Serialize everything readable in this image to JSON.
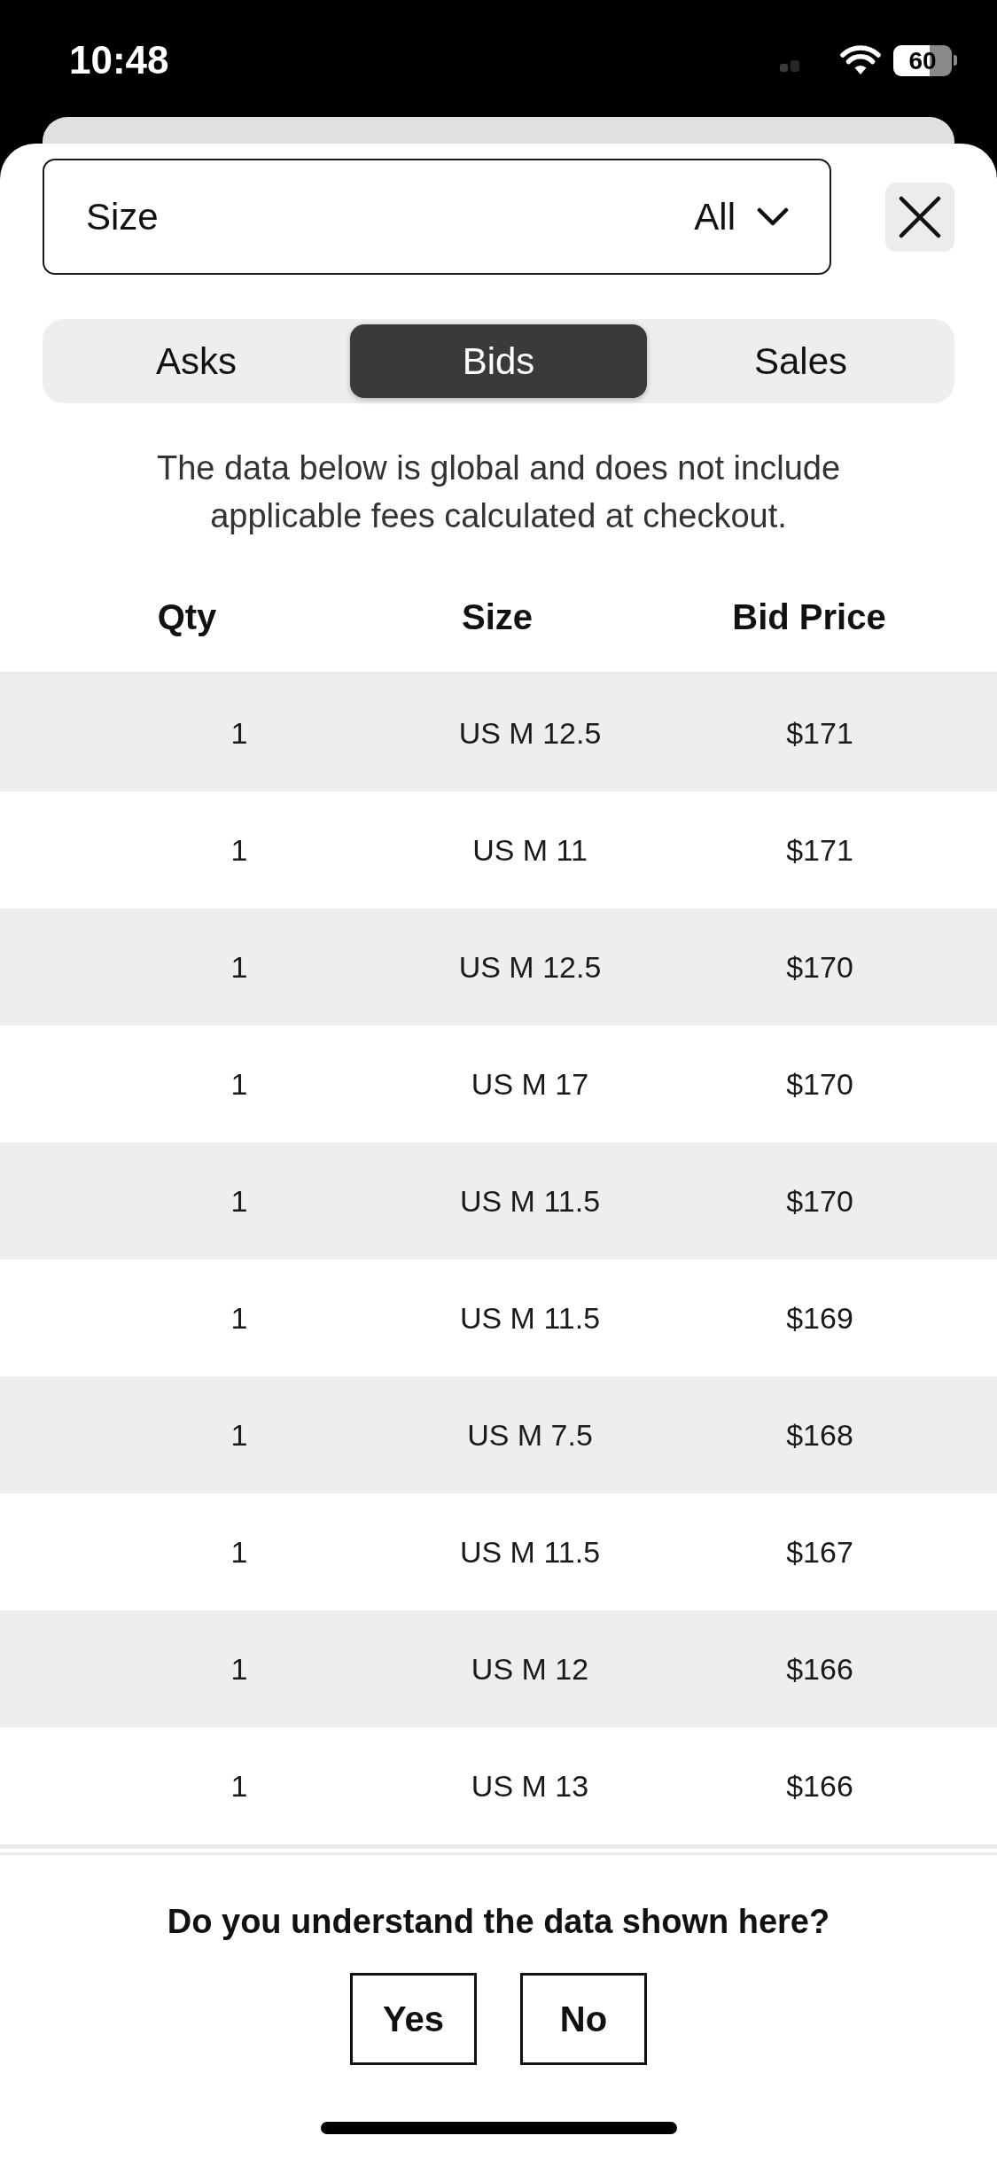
{
  "status_bar": {
    "time": "10:48",
    "battery": "60"
  },
  "filter": {
    "label": "Size",
    "value": "All"
  },
  "tabs": [
    {
      "label": "Asks",
      "selected": false
    },
    {
      "label": "Bids",
      "selected": true
    },
    {
      "label": "Sales",
      "selected": false
    }
  ],
  "notice": "The data below is global and does not include applicable fees calculated at checkout.",
  "table": {
    "columns": [
      "Qty",
      "Size",
      "Bid Price"
    ],
    "rows": [
      [
        "1",
        "US M 12.5",
        "$171"
      ],
      [
        "1",
        "US M 11",
        "$171"
      ],
      [
        "1",
        "US M 12.5",
        "$170"
      ],
      [
        "1",
        "US M 17",
        "$170"
      ],
      [
        "1",
        "US M 11.5",
        "$170"
      ],
      [
        "1",
        "US M 11.5",
        "$169"
      ],
      [
        "1",
        "US M 7.5",
        "$168"
      ],
      [
        "1",
        "US M 11.5",
        "$167"
      ],
      [
        "1",
        "US M 12",
        "$166"
      ],
      [
        "1",
        "US M 13",
        "$166"
      ]
    ]
  },
  "feedback": {
    "question": "Do you understand the data shown here?",
    "buttons": [
      "Yes",
      "No"
    ]
  }
}
